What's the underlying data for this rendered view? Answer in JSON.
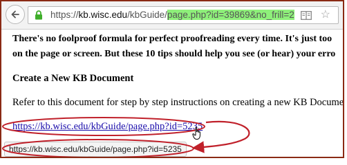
{
  "browser": {
    "back_icon": "back-arrow-icon",
    "lock_icon": "lock-icon",
    "reader_icon": "reader-view-icon",
    "star_icon": "bookmark-star-icon",
    "url_prefix": "https://",
    "url_host": "kb.wisc.edu",
    "url_path": "/kbGuide/",
    "url_highlight": "page.php?id=39869&no_frill=2",
    "highlight_color": "#8ef07a",
    "star_glyph": "☆"
  },
  "page": {
    "intro_line_1": "There's no foolproof formula for perfect proofreading every time. It's just too",
    "intro_line_2": "on the page or screen. But these 10 tips should help you see (or hear) your erro",
    "heading": "Create a New KB Document",
    "description": "Refer to this document for step by step instructions on creating a new KB Document",
    "link_text": "https://kb.wisc.edu/kbGuide/page.php?id=5235"
  },
  "statusbar": {
    "text": "https://kb.wisc.edu/kbGuide/page.php?id=5235"
  },
  "annotation": {
    "color": "#c0202a",
    "frame_color": "#8a2a14"
  }
}
